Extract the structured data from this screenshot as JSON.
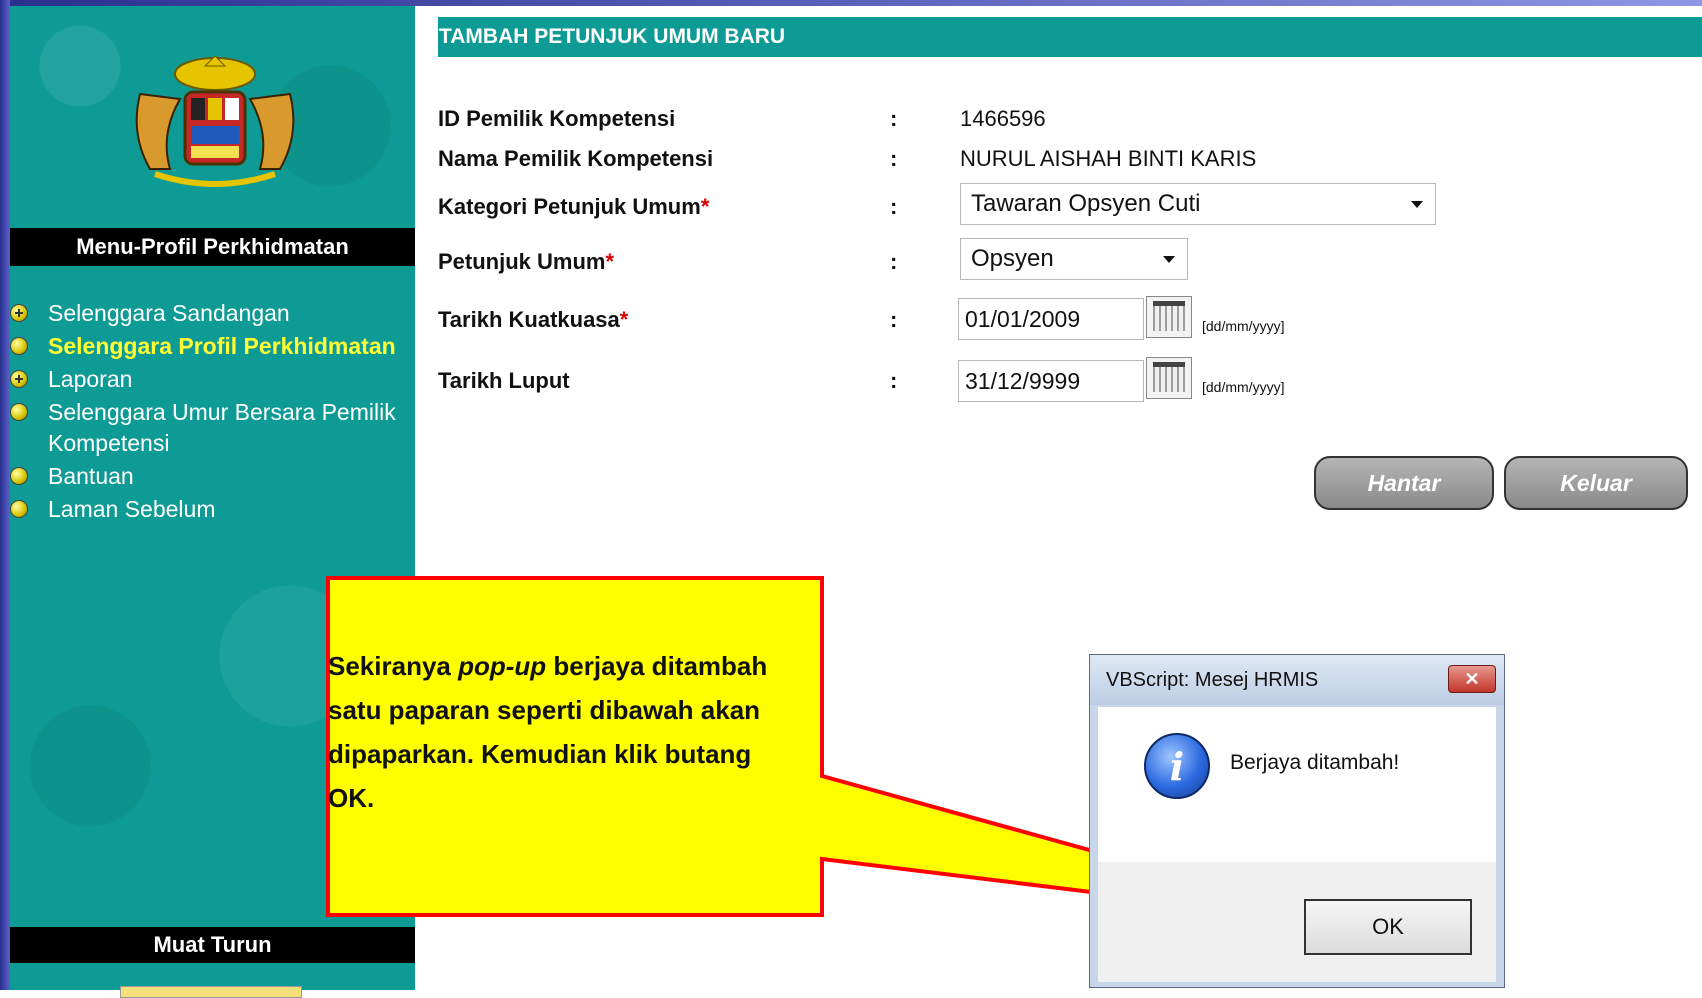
{
  "sidebar": {
    "menu_title": "Menu-Profil Perkhidmatan",
    "items": [
      {
        "label": "Selenggara Sandangan",
        "icon": "plus-bullet-icon"
      },
      {
        "label": "Selenggara Profil Perkhidmatan",
        "icon": "bullet-icon",
        "active": true
      },
      {
        "label": "Laporan",
        "icon": "plus-bullet-icon"
      },
      {
        "label": "Selenggara Umur Bersara Pemilik Kompetensi",
        "icon": "bullet-icon"
      },
      {
        "label": "Bantuan",
        "icon": "bullet-icon"
      },
      {
        "label": "Laman Sebelum",
        "icon": "bullet-icon"
      }
    ],
    "download_title": "Muat Turun"
  },
  "page": {
    "title": "TAMBAH PETUNJUK UMUM BARU"
  },
  "form": {
    "colon": ":",
    "required_mark": "*",
    "id_label": "ID Pemilik Kompetensi",
    "id_value": "1466596",
    "name_label": "Nama Pemilik Kompetensi",
    "name_value": "NURUL AISHAH BINTI KARIS",
    "category_label": "Kategori Petunjuk Umum",
    "category_value": "Tawaran Opsyen Cuti",
    "indicator_label": "Petunjuk Umum",
    "indicator_value": "Opsyen",
    "effective_label": "Tarikh Kuatkuasa",
    "effective_value": "01/01/2009",
    "expiry_label": "Tarikh Luput",
    "expiry_value": "31/12/9999",
    "date_hint": "[dd/mm/yyyy]",
    "submit_label": "Hantar",
    "exit_label": "Keluar"
  },
  "callout": {
    "text_before": "Sekiranya ",
    "text_italic": "pop-up",
    "text_after": " berjaya ditambah satu paparan seperti dibawah akan dipaparkan. Kemudian klik butang OK.",
    "fill_color": "#ffff00",
    "border_color": "#ff0000"
  },
  "dialog": {
    "title": "VBScript: Mesej HRMIS",
    "close_label": "✕",
    "message": "Berjaya ditambah!",
    "ok_label": "OK"
  },
  "colors": {
    "teal": "#0f9b95",
    "highlight": "#ffff33",
    "required": "#dd0000"
  }
}
